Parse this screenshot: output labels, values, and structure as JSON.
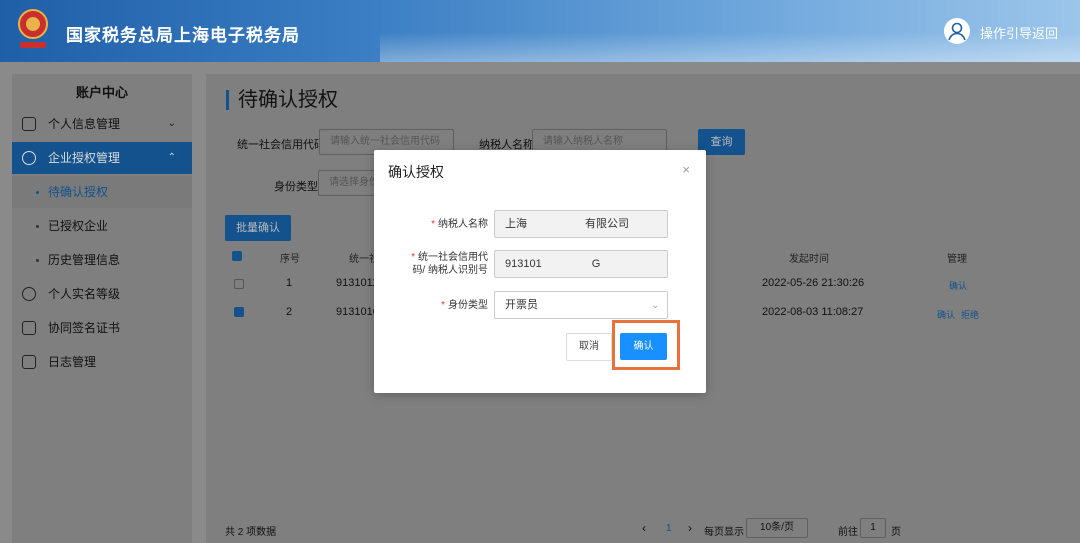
{
  "header": {
    "site_title": "国家税务总局上海电子税务局",
    "guide_link": "操作引导",
    "back_link": "返回"
  },
  "sidebar": {
    "title": "账户中心",
    "items": [
      {
        "label": "个人信息管理"
      },
      {
        "label": "企业授权管理"
      },
      {
        "label": "个人实名等级"
      },
      {
        "label": "协同签名证书"
      },
      {
        "label": "日志管理"
      }
    ],
    "subitems": [
      {
        "label": "待确认授权"
      },
      {
        "label": "已授权企业"
      },
      {
        "label": "历史管理信息"
      }
    ]
  },
  "page": {
    "title": "待确认授权",
    "filters": {
      "credit_code_label": "统一社会信用代码",
      "credit_code_placeholder": "请输入统一社会信用代码",
      "taxpayer_name_label": "纳税人名称",
      "taxpayer_name_placeholder": "请输入纳税人名称",
      "identity_type_label": "身份类型",
      "identity_type_placeholder": "请选择身份类型",
      "query_button": "查询"
    },
    "batch_confirm": "批量确认",
    "table": {
      "headers": {
        "seq": "序号",
        "code": "统一社",
        "time": "发起时间",
        "manage": "管理"
      },
      "rows": [
        {
          "seq": "1",
          "code": "9131011",
          "time": "2022-05-26 21:30:26",
          "action1": "确认",
          "action2": ""
        },
        {
          "seq": "2",
          "code": "9131010",
          "time": "2022-08-03 11:08:27",
          "action1": "确认",
          "action2": "拒绝"
        }
      ]
    },
    "footer": {
      "total": "共 2 项数据",
      "prev": "‹",
      "page": "1",
      "next": "›",
      "page_size_label": "每页显示",
      "page_size": "10条/页",
      "goto_label": "前往",
      "goto_value": "1",
      "page_unit": "页"
    }
  },
  "modal": {
    "title": "确认授权",
    "close": "×",
    "name_label": "纳税人名称",
    "name_value_pre": "上海",
    "name_value_post": "有限公司",
    "code_label_line1": "统一社会信用代",
    "code_label_line2": "码/ 纳税人识别号",
    "code_value_pre": "913101",
    "code_value_post": "G",
    "identity_label": "身份类型",
    "identity_value": "开票员",
    "cancel": "取消",
    "confirm": "确认"
  }
}
